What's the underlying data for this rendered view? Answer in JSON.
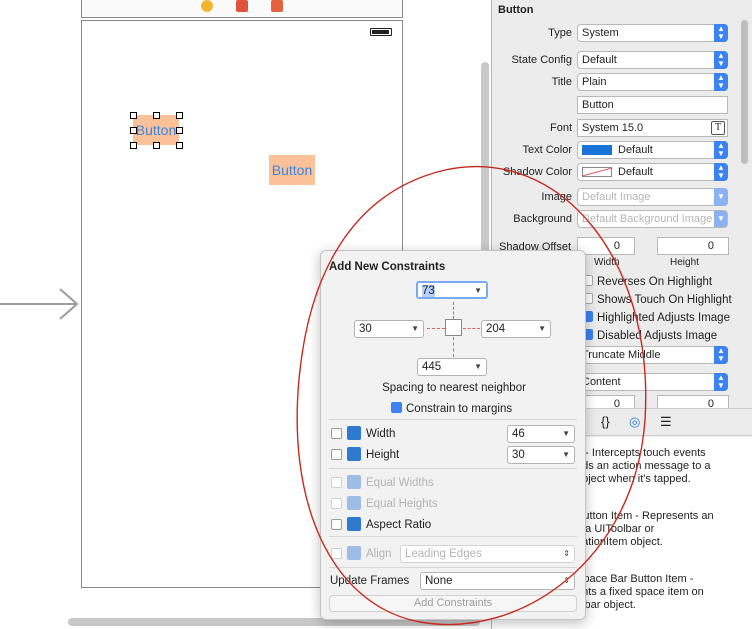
{
  "canvas": {
    "selected_button_label": "Button",
    "other_button_label": "Button"
  },
  "inspector": {
    "header": "Button",
    "rows": {
      "type": {
        "label": "Type",
        "value": "System"
      },
      "state_config": {
        "label": "State Config",
        "value": "Default"
      },
      "title": {
        "label": "Title",
        "value": "Plain"
      },
      "title_text": "Button",
      "font": {
        "label": "Font",
        "value": "System 15.0"
      },
      "text_color": {
        "label": "Text Color",
        "value": "Default"
      },
      "shadow_color": {
        "label": "Shadow Color",
        "value": "Default"
      },
      "image": {
        "label": "Image",
        "placeholder": "Default Image"
      },
      "background": {
        "label": "Background",
        "placeholder": "Default Background Image"
      },
      "shadow_offset": {
        "label": "Shadow Offset",
        "width": "0",
        "height": "0",
        "width_label": "Width",
        "height_label": "Height"
      }
    },
    "checkboxes": [
      "Reverses On Highlight",
      "Shows Touch On Highlight",
      "Highlighted Adjusts Image",
      "Disabled Adjusts Image"
    ],
    "line_break": "Truncate Middle",
    "edge": "Content",
    "insets": {
      "left": "0",
      "right": "0"
    },
    "tab_icons": [
      "{}",
      "◎",
      "☰"
    ],
    "library": {
      "item1": "n - Intercepts touch events\nnds an action message to a\nobject when it's tapped.",
      "item2": "Button Item - Represents an\nn a UIToolbar or\ngationItem object.",
      "item3": "Space Bar Button Item -\nents a fixed space item on\nolbar object."
    },
    "text_color_swatch": "#1a73d9"
  },
  "popover": {
    "title": "Add New Constraints",
    "top": "73",
    "left": "30",
    "right": "204",
    "bottom": "445",
    "spacing_label": "Spacing to nearest neighbor",
    "constrain_margins": "Constrain to margins",
    "width_label": "Width",
    "width_value": "46",
    "height_label": "Height",
    "height_value": "30",
    "equal_widths": "Equal Widths",
    "equal_heights": "Equal Heights",
    "aspect_ratio": "Aspect Ratio",
    "align_label": "Align",
    "align_value": "Leading Edges",
    "update_frames_label": "Update Frames",
    "update_frames_value": "None",
    "add_button": "Add Constraints"
  }
}
